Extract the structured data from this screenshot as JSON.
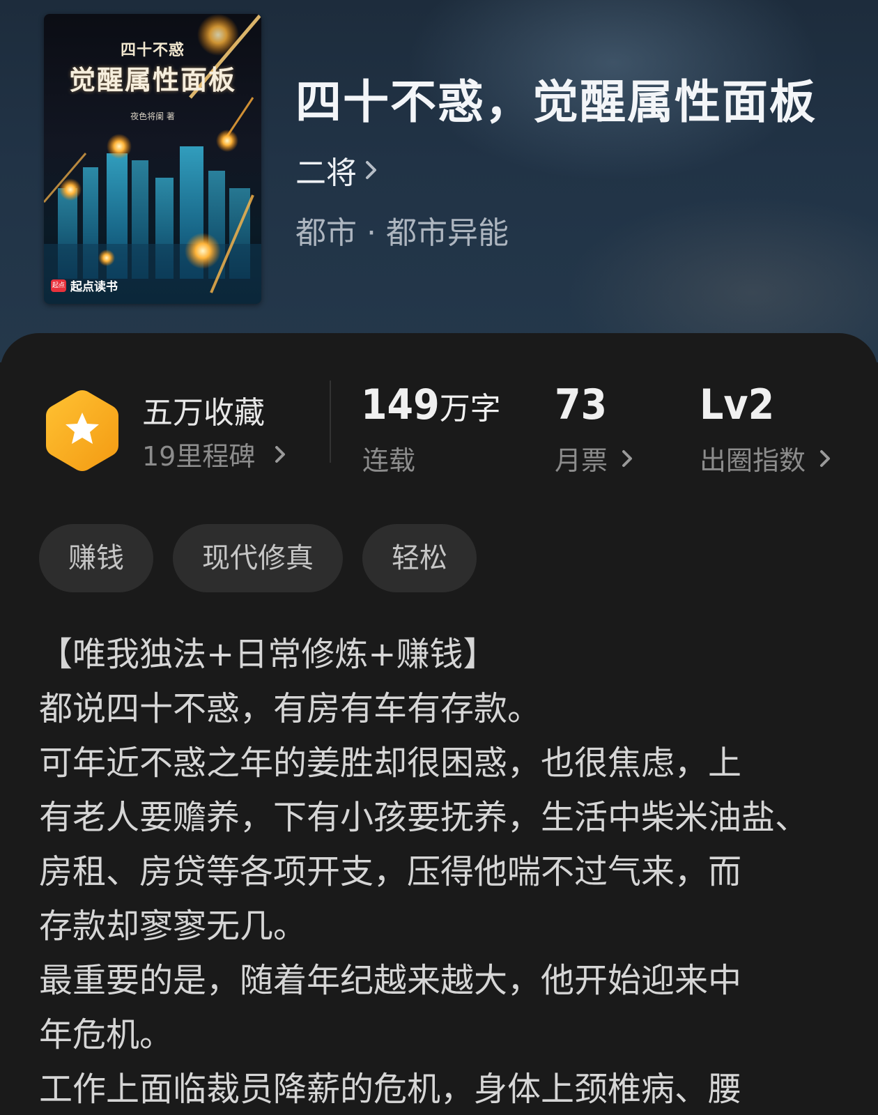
{
  "cover": {
    "small_title": "四十不惑",
    "title": "觉醒属性面板",
    "author": "夜色将阑 著",
    "brand_badge": "起点",
    "brand": "起点读书"
  },
  "book": {
    "title": "四十不惑，觉醒属性面板",
    "author": "二将",
    "genre": "都市 · 都市异能"
  },
  "stats": {
    "collect_main": "五万收藏",
    "collect_sub": "19里程碑",
    "words_value": "149",
    "words_unit": "万字",
    "words_label": "连载",
    "tickets_value": "73",
    "tickets_label": "月票",
    "level_value": "Lv2",
    "level_label": "出圈指数"
  },
  "tags": [
    "赚钱",
    "现代修真",
    "轻松"
  ],
  "description": [
    "【唯我独法+日常修炼+赚钱】",
    "都说四十不惑，有房有车有存款。",
    "可年近不惑之年的姜胜却很困惑，也很焦虑，上",
    "有老人要赡养，下有小孩要抚养，生活中柴米油盐、",
    "房租、房贷等各项开支，压得他喘不过气来，而",
    "存款却寥寥无几。",
    "最重要的是，随着年纪越来越大，他开始迎来中",
    "年危机。",
    "工作上面临裁员降薪的危机，身体上颈椎病、腰"
  ],
  "colors": {
    "background": "#1a1a1a",
    "header_top": "#1d2c3c",
    "accent_badge": "#f5a623",
    "tag_bg": "#2d2d2d"
  },
  "icons": {
    "milestone": "star-hexagon-icon",
    "chevron": "chevron-right-icon"
  }
}
